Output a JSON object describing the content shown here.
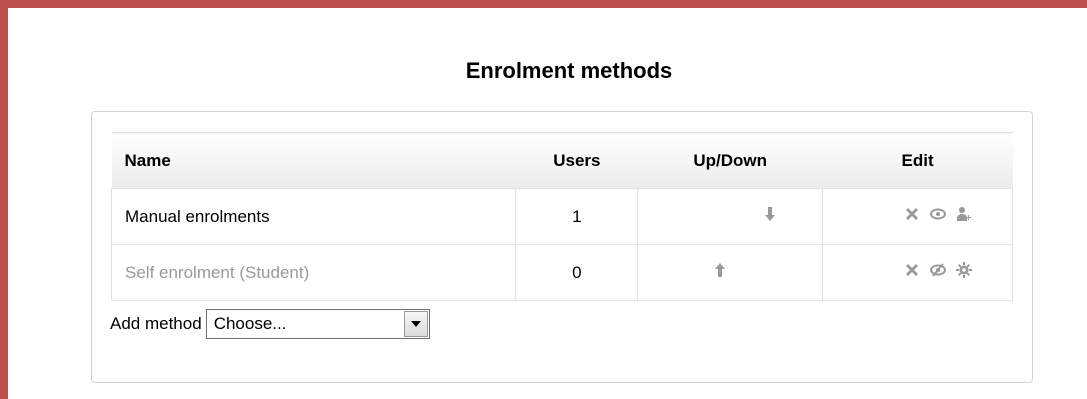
{
  "page_title": "Enrolment methods",
  "table": {
    "headers": {
      "name": "Name",
      "users": "Users",
      "updown": "Up/Down",
      "edit": "Edit"
    },
    "rows": [
      {
        "name": "Manual enrolments",
        "users": "1",
        "move": "down-icon",
        "edit_icons": [
          "delete-icon",
          "eye-icon",
          "enrol-users-icon"
        ],
        "enabled": true
      },
      {
        "name": "Self enrolment (Student)",
        "users": "0",
        "move": "up-icon",
        "edit_icons": [
          "delete-icon",
          "eye-slash-icon",
          "gear-icon"
        ],
        "enabled": false
      }
    ]
  },
  "add_method": {
    "label": "Add method",
    "selected": "Choose..."
  },
  "colors": {
    "frame": "#c0504d",
    "icon": "#999999",
    "disabled_text": "#999999"
  }
}
